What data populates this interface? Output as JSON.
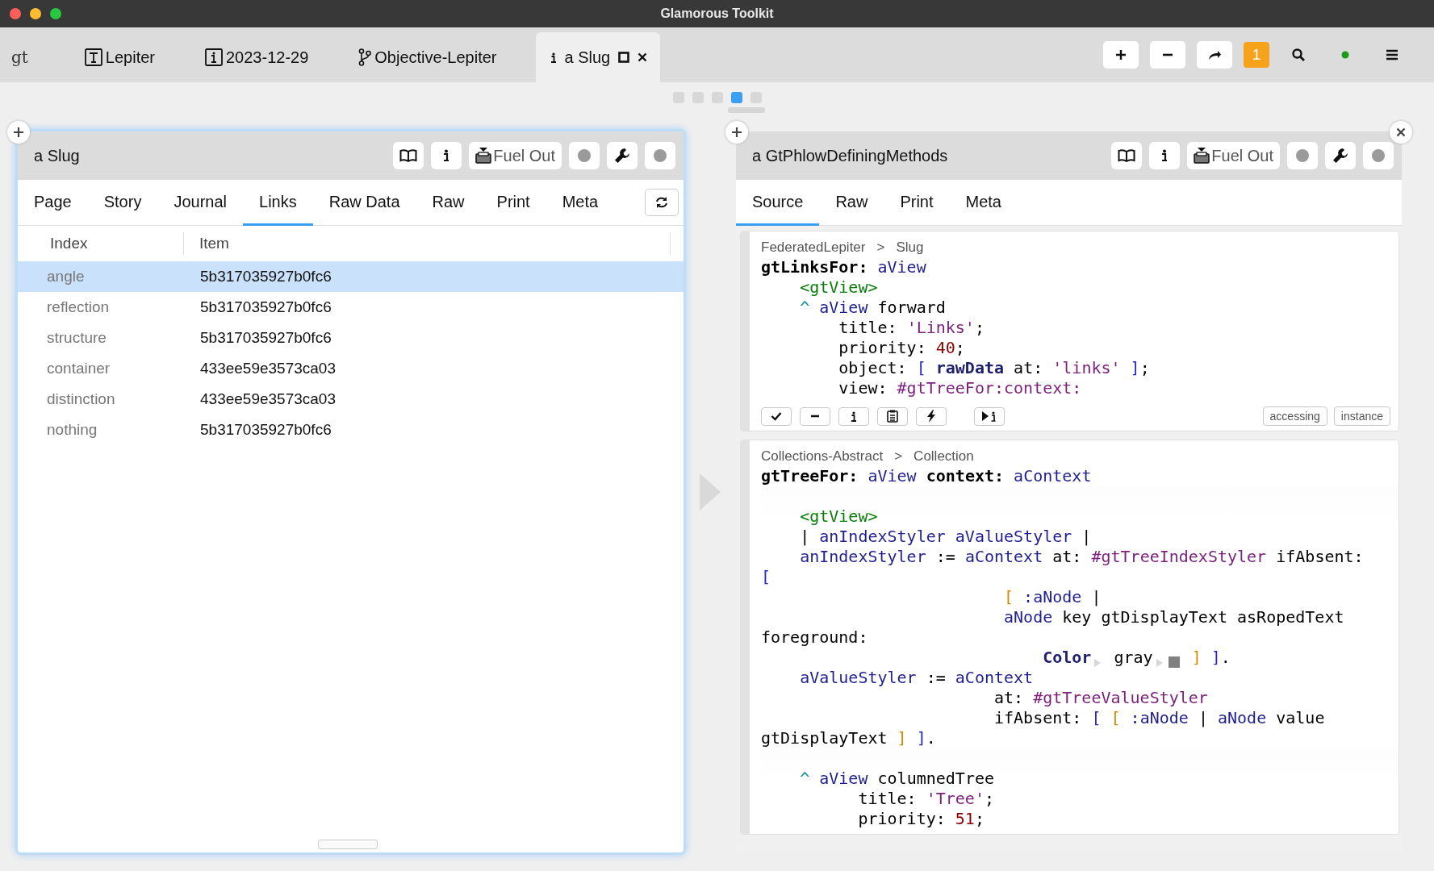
{
  "window": {
    "title": "Glamorous Toolkit"
  },
  "tabs": [
    {
      "kind": "logo",
      "label": "gt",
      "selected": false
    },
    {
      "kind": "page",
      "label": "Lepiter",
      "selected": false
    },
    {
      "kind": "info",
      "label": "2023-12-29",
      "selected": false
    },
    {
      "kind": "branch",
      "label": "Objective-Lepiter",
      "selected": false
    },
    {
      "kind": "inspector",
      "label": "a Slug",
      "selected": true
    }
  ],
  "toolbar": [
    {
      "kind": "add"
    },
    {
      "kind": "remove"
    },
    {
      "kind": "share"
    },
    {
      "kind": "badge",
      "label": "1"
    },
    {
      "kind": "search"
    },
    {
      "kind": "status"
    },
    {
      "kind": "menu"
    }
  ],
  "pager": [
    {
      "selected": false
    },
    {
      "selected": false
    },
    {
      "selected": false
    },
    {
      "selected": true
    },
    {
      "selected": false
    }
  ],
  "panes": [
    {
      "kind": "table",
      "title": "a Slug",
      "focused": true,
      "closable": false,
      "refresh_button": true,
      "header_buttons": [
        {
          "kind": "book"
        },
        {
          "kind": "info"
        },
        {
          "kind": "fuel",
          "label": "Fuel Out"
        },
        {
          "kind": "dot"
        },
        {
          "kind": "wrench"
        },
        {
          "kind": "dot"
        }
      ],
      "tabs": [
        {
          "label": "Page",
          "selected": false
        },
        {
          "label": "Story",
          "selected": false
        },
        {
          "label": "Journal",
          "selected": false
        },
        {
          "label": "Links",
          "selected": true
        },
        {
          "label": "Raw Data",
          "selected": false
        },
        {
          "label": "Raw",
          "selected": false
        },
        {
          "label": "Print",
          "selected": false
        },
        {
          "label": "Meta",
          "selected": false
        }
      ],
      "table": {
        "columns": [
          "Index",
          "Item"
        ],
        "rows": [
          {
            "index": "angle",
            "item": "5b317035927b0fc6",
            "selected": true
          },
          {
            "index": "reflection",
            "item": "5b317035927b0fc6",
            "selected": false
          },
          {
            "index": "structure",
            "item": "5b317035927b0fc6",
            "selected": false
          },
          {
            "index": "container",
            "item": "433ee59e3573ca03",
            "selected": false
          },
          {
            "index": "distinction",
            "item": "433ee59e3573ca03",
            "selected": false
          },
          {
            "index": "nothing",
            "item": "5b317035927b0fc6",
            "selected": false
          }
        ]
      }
    },
    {
      "kind": "methods",
      "title": "a GtPhlowDefiningMethods",
      "focused": false,
      "closable": true,
      "refresh_button": false,
      "header_buttons": [
        {
          "kind": "book"
        },
        {
          "kind": "info"
        },
        {
          "kind": "fuel",
          "label": "Fuel Out"
        },
        {
          "kind": "dot"
        },
        {
          "kind": "wrench"
        },
        {
          "kind": "dot"
        }
      ],
      "tabs": [
        {
          "label": "Source",
          "selected": true
        },
        {
          "label": "Raw",
          "selected": false
        },
        {
          "label": "Print",
          "selected": false
        },
        {
          "label": "Meta",
          "selected": false
        }
      ],
      "methods": [
        {
          "breadcrumb": {
            "package": "FederatedLepiter",
            "separator": ">",
            "class": "Slug"
          },
          "lines": [
            {
              "gap_before": false,
              "tokens": [
                {
                  "text": "gtLinksFor: ",
                  "kind": "selector"
                },
                {
                  "text": "aView",
                  "kind": "argument"
                }
              ]
            },
            {
              "gap_before": false,
              "tokens": [
                {
                  "text": "    <gtView>",
                  "kind": "pragma"
                }
              ]
            },
            {
              "gap_before": false,
              "tokens": [
                {
                  "text": "    ^ ",
                  "kind": "caret"
                },
                {
                  "text": "aView",
                  "kind": "argument"
                },
                {
                  "text": " forward",
                  "kind": "plain"
                }
              ]
            },
            {
              "gap_before": false,
              "tokens": [
                {
                  "text": "        title: ",
                  "kind": "plain"
                },
                {
                  "text": "'Links'",
                  "kind": "string"
                },
                {
                  "text": ";",
                  "kind": "plain"
                }
              ]
            },
            {
              "gap_before": false,
              "tokens": [
                {
                  "text": "        priority: ",
                  "kind": "plain"
                },
                {
                  "text": "40",
                  "kind": "number"
                },
                {
                  "text": ";",
                  "kind": "plain"
                }
              ]
            },
            {
              "gap_before": false,
              "tokens": [
                {
                  "text": "        object: ",
                  "kind": "plain"
                },
                {
                  "text": "[ ",
                  "kind": "bracket"
                },
                {
                  "text": "rawData",
                  "kind": "variable"
                },
                {
                  "text": " at: ",
                  "kind": "plain"
                },
                {
                  "text": "'links' ",
                  "kind": "string"
                },
                {
                  "text": "]",
                  "kind": "bracket"
                },
                {
                  "text": ";",
                  "kind": "plain"
                }
              ]
            },
            {
              "gap_before": false,
              "tokens": [
                {
                  "text": "        view: ",
                  "kind": "plain"
                },
                {
                  "text": "#gtTreeFor:context:",
                  "kind": "symbol"
                }
              ]
            }
          ],
          "actions": [
            {
              "kind": "accept"
            },
            {
              "kind": "remove"
            },
            {
              "kind": "inspect"
            },
            {
              "kind": "copy"
            },
            {
              "kind": "run"
            },
            {
              "kind": "debug"
            }
          ],
          "tags": [
            "accessing",
            "instance"
          ]
        },
        {
          "breadcrumb": {
            "package": "Collections-Abstract",
            "separator": ">",
            "class": "Collection"
          },
          "lines": [
            {
              "gap_before": false,
              "tokens": [
                {
                  "text": "gtTreeFor: ",
                  "kind": "selector"
                },
                {
                  "text": "aView",
                  "kind": "argument"
                },
                {
                  "text": " context: ",
                  "kind": "selector"
                },
                {
                  "text": "aContext",
                  "kind": "argument"
                }
              ]
            },
            {
              "gap_before": true,
              "tokens": [
                {
                  "text": "    <gtView>",
                  "kind": "pragma"
                }
              ]
            },
            {
              "gap_before": false,
              "tokens": [
                {
                  "text": "    | ",
                  "kind": "plain"
                },
                {
                  "text": "anIndexStyler aValueStyler",
                  "kind": "argument"
                },
                {
                  "text": " |",
                  "kind": "plain"
                }
              ]
            },
            {
              "gap_before": false,
              "tokens": [
                {
                  "text": "    anIndexStyler",
                  "kind": "argument"
                },
                {
                  "text": " := ",
                  "kind": "plain"
                },
                {
                  "text": "aContext",
                  "kind": "argument"
                },
                {
                  "text": " at: ",
                  "kind": "plain"
                },
                {
                  "text": "#gtTreeIndexStyler",
                  "kind": "symbol"
                },
                {
                  "text": " ifAbsent:",
                  "kind": "plain"
                }
              ]
            },
            {
              "gap_before": false,
              "tokens": [
                {
                  "text": "[",
                  "kind": "bracket"
                }
              ]
            },
            {
              "gap_before": false,
              "tokens": [
                {
                  "text": "                         [ ",
                  "kind": "block_bracket"
                },
                {
                  "text": ":aNode",
                  "kind": "argument"
                },
                {
                  "text": " |",
                  "kind": "plain"
                }
              ]
            },
            {
              "gap_before": false,
              "tokens": [
                {
                  "text": "                         aNode",
                  "kind": "argument"
                },
                {
                  "text": " key gtDisplayText asRopedText",
                  "kind": "plain"
                }
              ]
            },
            {
              "gap_before": false,
              "tokens": [
                {
                  "text": "foreground:",
                  "kind": "plain"
                }
              ]
            },
            {
              "gap_before": false,
              "tokens": [
                {
                  "text": "                             Color",
                  "kind": "variable"
                },
                {
                  "kind": "arrow"
                },
                {
                  "text": " gray",
                  "kind": "plain"
                },
                {
                  "kind": "arrow"
                },
                {
                  "kind": "swatch"
                },
                {
                  "text": " ]",
                  "kind": "block_bracket"
                },
                {
                  "text": " ]",
                  "kind": "bracket"
                },
                {
                  "text": ".",
                  "kind": "plain"
                }
              ]
            },
            {
              "gap_before": false,
              "tokens": [
                {
                  "text": "    aValueStyler",
                  "kind": "argument"
                },
                {
                  "text": " := ",
                  "kind": "plain"
                },
                {
                  "text": "aContext",
                  "kind": "argument"
                }
              ]
            },
            {
              "gap_before": false,
              "tokens": [
                {
                  "text": "                        at: ",
                  "kind": "plain"
                },
                {
                  "text": "#gtTreeValueStyler",
                  "kind": "symbol"
                }
              ]
            },
            {
              "gap_before": false,
              "tokens": [
                {
                  "text": "                        ifAbsent: ",
                  "kind": "plain"
                },
                {
                  "text": "[ ",
                  "kind": "bracket"
                },
                {
                  "text": "[ ",
                  "kind": "block_bracket"
                },
                {
                  "text": ":aNode",
                  "kind": "argument"
                },
                {
                  "text": " | ",
                  "kind": "plain"
                },
                {
                  "text": "aNode",
                  "kind": "argument"
                },
                {
                  "text": " value",
                  "kind": "plain"
                }
              ]
            },
            {
              "gap_before": false,
              "tokens": [
                {
                  "text": "gtDisplayText ",
                  "kind": "plain"
                },
                {
                  "text": "] ",
                  "kind": "block_bracket"
                },
                {
                  "text": "]",
                  "kind": "bracket"
                },
                {
                  "text": ".",
                  "kind": "plain"
                }
              ]
            },
            {
              "gap_before": true,
              "tokens": [
                {
                  "text": "    ^ ",
                  "kind": "caret"
                },
                {
                  "text": "aView",
                  "kind": "argument"
                },
                {
                  "text": " columnedTree",
                  "kind": "plain"
                }
              ]
            },
            {
              "gap_before": false,
              "tokens": [
                {
                  "text": "          title: ",
                  "kind": "plain"
                },
                {
                  "text": "'Tree'",
                  "kind": "string"
                },
                {
                  "text": ";",
                  "kind": "plain"
                }
              ]
            },
            {
              "gap_before": false,
              "tokens": [
                {
                  "text": "          priority: ",
                  "kind": "plain"
                },
                {
                  "text": "51",
                  "kind": "number"
                },
                {
                  "text": ";",
                  "kind": "plain"
                }
              ]
            }
          ]
        }
      ]
    }
  ]
}
